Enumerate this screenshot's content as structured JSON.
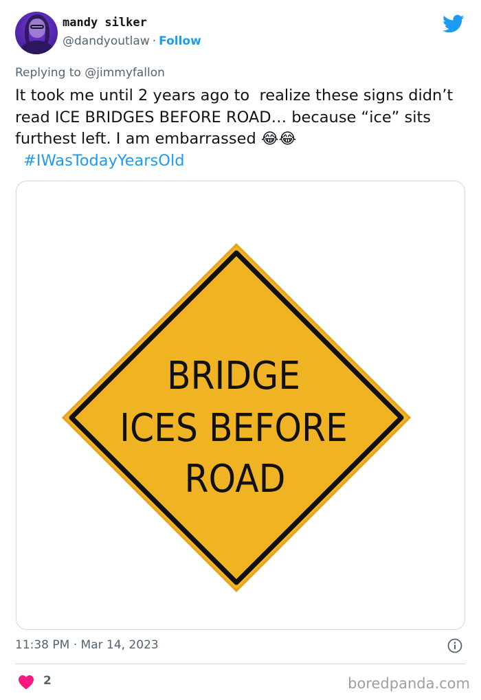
{
  "author": {
    "display_name": "mandy silker",
    "handle": "@dandyoutlaw",
    "separator": "·",
    "follow_label": "Follow"
  },
  "reply": {
    "prefix": "Replying to",
    "mention": "@jimmyfallon"
  },
  "tweet": {
    "text": "It took me until 2 years ago to  realize these signs didn’t read ICE BRIDGES BEFORE ROAD… because “ice” sits furthest left. I am embarrassed ",
    "emoji": "😂😂",
    "hashtag": "#IWasTodayYearsOld"
  },
  "media": {
    "sign_lines": [
      "BRIDGE",
      "ICES BEFORE",
      "ROAD"
    ],
    "sign_color": "#f0b323",
    "sign_border_color": "#111111"
  },
  "meta": {
    "time": "11:38 PM",
    "separator": "·",
    "date": "Mar 14, 2023"
  },
  "engagement": {
    "likes": "2"
  },
  "watermark": "boredpanda.com",
  "icons": {
    "brand": "twitter-bird-icon",
    "info": "info-icon",
    "like": "heart-icon"
  },
  "colors": {
    "accent": "#1d9bf0",
    "secondary_text": "#536471",
    "heart": "#f91880",
    "border": "#cfd9de"
  }
}
